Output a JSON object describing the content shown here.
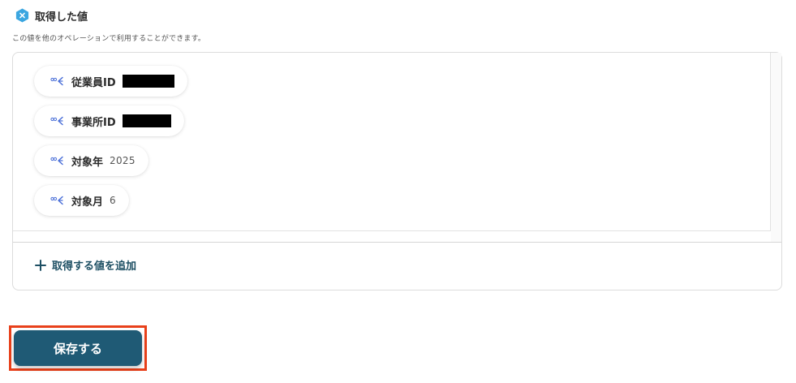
{
  "section": {
    "title": "取得した値",
    "description": "この値を他のオペレーションで利用することができます。"
  },
  "values": [
    {
      "label": "従業員ID",
      "value": "",
      "redacted": true
    },
    {
      "label": "事業所ID",
      "value": "",
      "redacted": true
    },
    {
      "label": "対象年",
      "value": "2025",
      "redacted": false
    },
    {
      "label": "対象月",
      "value": "6",
      "redacted": false
    }
  ],
  "actions": {
    "add_value_label": "取得する値を追加",
    "save_label": "保存する"
  },
  "colors": {
    "hex_icon": "#3ba6e0",
    "primary_button": "#1f5a75",
    "accent_text": "#1d4f63",
    "highlight_border": "#e8401a",
    "chip_icon": "#4a6fd8"
  },
  "icons": {
    "section": "hexagon-x-icon",
    "chip": "data-key-icon",
    "add": "plus-icon"
  }
}
